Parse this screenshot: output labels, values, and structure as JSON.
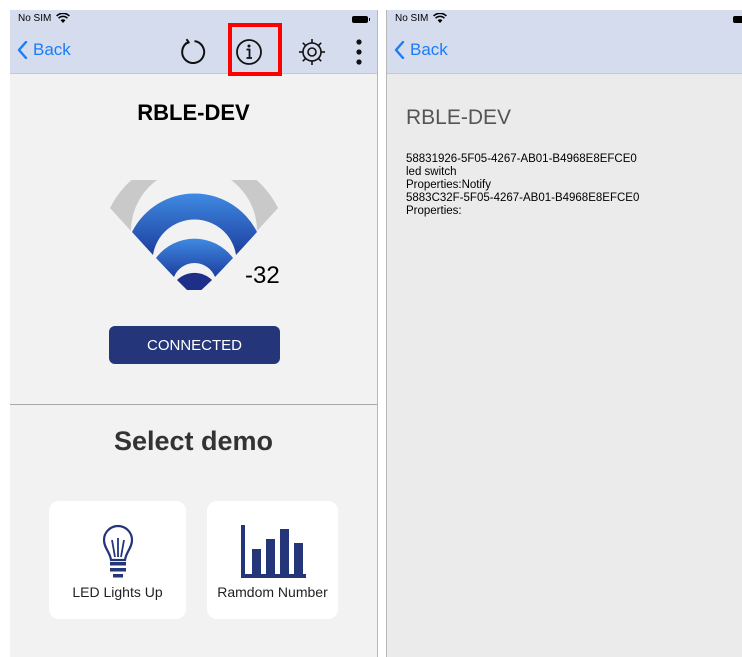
{
  "left_screen": {
    "status_bar": {
      "carrier": "No SIM",
      "wifi_icon": "wifi-icon",
      "battery_icon": "battery-icon"
    },
    "nav_bar": {
      "back_label": "Back",
      "back_icon": "chevron-left-icon",
      "actions": [
        "refresh-icon",
        "info-icon",
        "gear-icon",
        "more-vertical-icon"
      ],
      "highlighted_action": "info-icon",
      "highlight_color": "#ff0000"
    },
    "device_name": "RBLE-DEV",
    "signal": {
      "icon": "signal-strength-icon",
      "rssi": "-32"
    },
    "connection_status": "CONNECTED",
    "select_demo_title": "Select demo",
    "demos": [
      {
        "label": "LED Lights Up",
        "icon": "light-bulb-icon"
      },
      {
        "label": "Ramdom Number",
        "icon": "bar-chart-icon"
      }
    ]
  },
  "right_screen": {
    "status_bar": {
      "carrier": "No SIM",
      "wifi_icon": "wifi-icon",
      "battery_icon": "battery-icon"
    },
    "nav_bar": {
      "back_label": "Back",
      "back_icon": "chevron-left-icon"
    },
    "device_name": "RBLE-DEV",
    "details": [
      "58831926-5F05-4267-AB01-B4968E8EFCE0",
      "led switch",
      "Properties:Notify",
      "5883C32F-5F05-4267-AB01-B4968E8EFCE0",
      "Properties:"
    ]
  },
  "colors": {
    "nav_background": "#d4dcee",
    "link_blue": "#1a7cf8",
    "button_navy": "#25357a",
    "icon_navy": "#25357a",
    "signal_blue": "#2a6fd0",
    "signal_gray": "#c9c9c9"
  }
}
